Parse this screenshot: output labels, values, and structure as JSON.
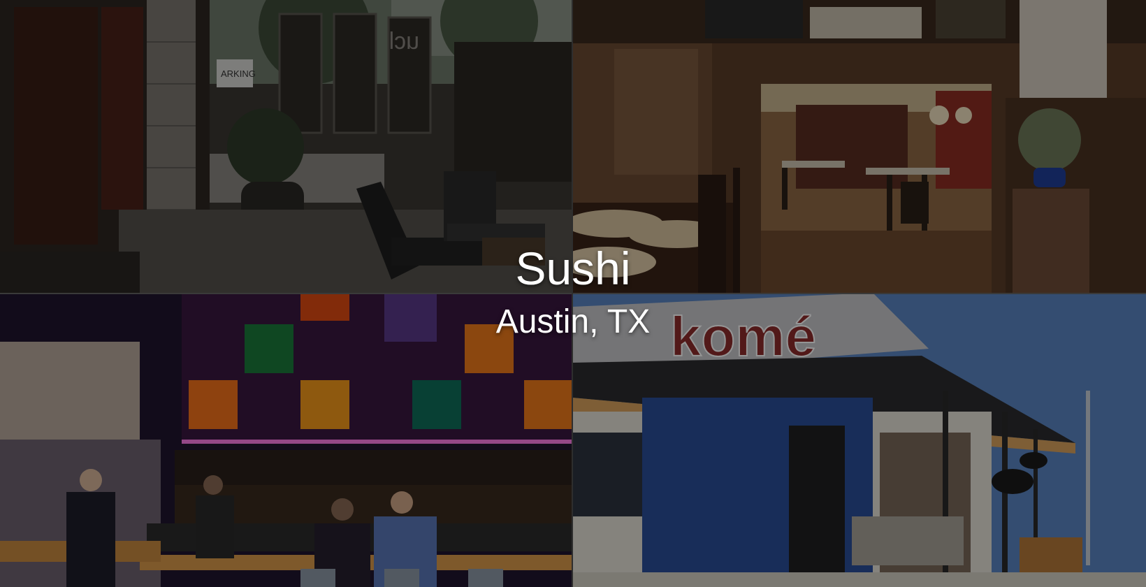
{
  "hero": {
    "title": "Sushi",
    "subtitle": "Austin, TX"
  },
  "photos": [
    {
      "name": "patio-photo",
      "sign_text": "ucl",
      "parking_text": "ARKING"
    },
    {
      "name": "dining-room-photo"
    },
    {
      "name": "sushi-bar-photo"
    },
    {
      "name": "kome-storefront-photo",
      "sign_text": "komé"
    }
  ],
  "colors": {
    "overlay": "#000000",
    "text": "#ffffff",
    "kome_sign": "#8e2b2b",
    "sky": "#5b86c3"
  }
}
